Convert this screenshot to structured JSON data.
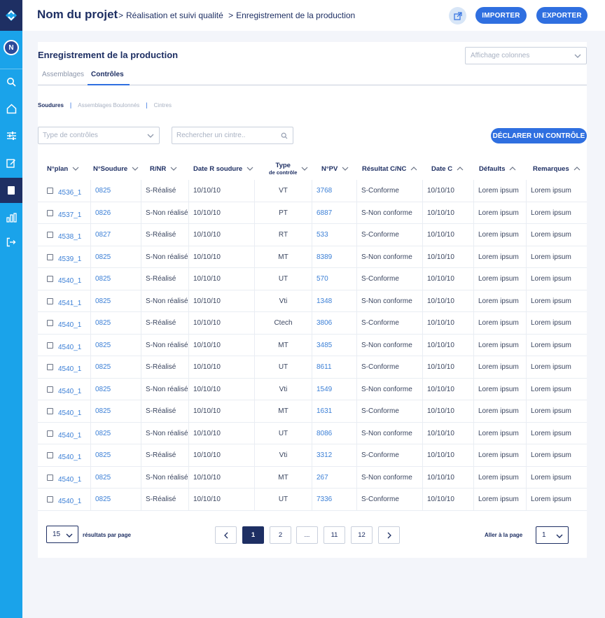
{
  "sidebar": {
    "avatar_initial": "N",
    "icons": [
      "logo-icon",
      "search-icon",
      "home-icon",
      "sliders-icon",
      "edit-icon",
      "document-icon",
      "bar-chart-icon",
      "logout-icon"
    ],
    "accent": "#1aa3ea",
    "dark": "#1e2f63"
  },
  "header": {
    "project_title": "Nom du projet",
    "breadcrumb": [
      "Réalisation et suivi qualité",
      "Enregistrement de la production"
    ],
    "separator": ">",
    "import_label": "IMPORTER",
    "export_label": "EXPORTER"
  },
  "main": {
    "page_title": "Enregistrement de la production",
    "columns_select_placeholder": "Affichage colonnes",
    "tabs": [
      {
        "label": "Assemblages",
        "active": false
      },
      {
        "label": "Contrôles",
        "active": true
      }
    ],
    "subtabs": [
      {
        "label": "Soudures",
        "active": true
      },
      {
        "label": "Assemblages Boulonnés",
        "active": false
      },
      {
        "label": "Cintres",
        "active": false
      }
    ],
    "subtab_separator": "|",
    "filter_type_placeholder": "Type de contrôles",
    "search_placeholder": "Rechercher un cintre..",
    "declare_label": "DÉCLARER UN CONTRÔLE"
  },
  "table": {
    "headers": [
      {
        "label": "N°plan",
        "sub": "",
        "arrow": "down"
      },
      {
        "label": "N°Soudure",
        "sub": "",
        "arrow": "down"
      },
      {
        "label": "R/NR",
        "sub": "",
        "arrow": "down"
      },
      {
        "label": "Date R soudure",
        "sub": "",
        "arrow": "down"
      },
      {
        "label": "Type",
        "sub": "de contrôle",
        "arrow": "down"
      },
      {
        "label": "N°PV",
        "sub": "",
        "arrow": "down"
      },
      {
        "label": "Résultat C/NC",
        "sub": "",
        "arrow": "up"
      },
      {
        "label": "Date C",
        "sub": "",
        "arrow": "up"
      },
      {
        "label": "Défaults",
        "sub": "",
        "arrow": "up"
      },
      {
        "label": "Remarques",
        "sub": "",
        "arrow": "up"
      }
    ],
    "rows": [
      [
        "4536_1",
        "0825",
        "S-Réalisé",
        "10/10/10",
        "VT",
        "3768",
        "S-Conforme",
        "10/10/10",
        "Lorem ipsum",
        "Lorem ipsum"
      ],
      [
        "4537_1",
        "0826",
        "S-Non réalisé",
        "10/10/10",
        "PT",
        "6887",
        "S-Non conforme",
        "10/10/10",
        "Lorem ipsum",
        "Lorem ipsum"
      ],
      [
        "4538_1",
        "0827",
        "S-Réalisé",
        "10/10/10",
        "RT",
        "533",
        "S-Conforme",
        "10/10/10",
        "Lorem ipsum",
        "Lorem ipsum"
      ],
      [
        "4539_1",
        "0825",
        "S-Non réalisé",
        "10/10/10",
        "MT",
        "8389",
        "S-Non conforme",
        "10/10/10",
        "Lorem ipsum",
        "Lorem ipsum"
      ],
      [
        "4540_1",
        "0825",
        "S-Réalisé",
        "10/10/10",
        "UT",
        "570",
        "S-Conforme",
        "10/10/10",
        "Lorem ipsum",
        "Lorem ipsum"
      ],
      [
        "4541_1",
        "0825",
        "S-Non réalisé",
        "10/10/10",
        "Vti",
        "1348",
        "S-Non conforme",
        "10/10/10",
        "Lorem ipsum",
        "Lorem ipsum"
      ],
      [
        "4540_1",
        "0825",
        "S-Réalisé",
        "10/10/10",
        "Ctech",
        "3806",
        "S-Conforme",
        "10/10/10",
        "Lorem ipsum",
        "Lorem ipsum"
      ],
      [
        "4540_1",
        "0825",
        "S-Non réalisé",
        "10/10/10",
        "MT",
        "3485",
        "S-Non conforme",
        "10/10/10",
        "Lorem ipsum",
        "Lorem ipsum"
      ],
      [
        "4540_1",
        "0825",
        "S-Réalisé",
        "10/10/10",
        "UT",
        "8611",
        "S-Conforme",
        "10/10/10",
        "Lorem ipsum",
        "Lorem ipsum"
      ],
      [
        "4540_1",
        "0825",
        "S-Non réalisé",
        "10/10/10",
        "Vti",
        "1549",
        "S-Non conforme",
        "10/10/10",
        "Lorem ipsum",
        "Lorem ipsum"
      ],
      [
        "4540_1",
        "0825",
        "S-Réalisé",
        "10/10/10",
        "MT",
        "1631",
        "S-Conforme",
        "10/10/10",
        "Lorem ipsum",
        "Lorem ipsum"
      ],
      [
        "4540_1",
        "0825",
        "S-Non réalisé",
        "10/10/10",
        "UT",
        "8086",
        "S-Non conforme",
        "10/10/10",
        "Lorem ipsum",
        "Lorem ipsum"
      ],
      [
        "4540_1",
        "0825",
        "S-Réalisé",
        "10/10/10",
        "Vti",
        "3312",
        "S-Conforme",
        "10/10/10",
        "Lorem ipsum",
        "Lorem ipsum"
      ],
      [
        "4540_1",
        "0825",
        "S-Non réalisé",
        "10/10/10",
        "MT",
        "267",
        "S-Non conforme",
        "10/10/10",
        "Lorem ipsum",
        "Lorem ipsum"
      ],
      [
        "4540_1",
        "0825",
        "S-Réalisé",
        "10/10/10",
        "UT",
        "7336",
        "S-Conforme",
        "10/10/10",
        "Lorem ipsum",
        "Lorem ipsum"
      ]
    ]
  },
  "footer": {
    "per_page_value": "15",
    "per_page_label": "résultats par page",
    "pages": [
      "1",
      "2",
      "...",
      "11",
      "12"
    ],
    "current_page": "1",
    "goto_label": "Aller à la page",
    "goto_value": "1"
  }
}
